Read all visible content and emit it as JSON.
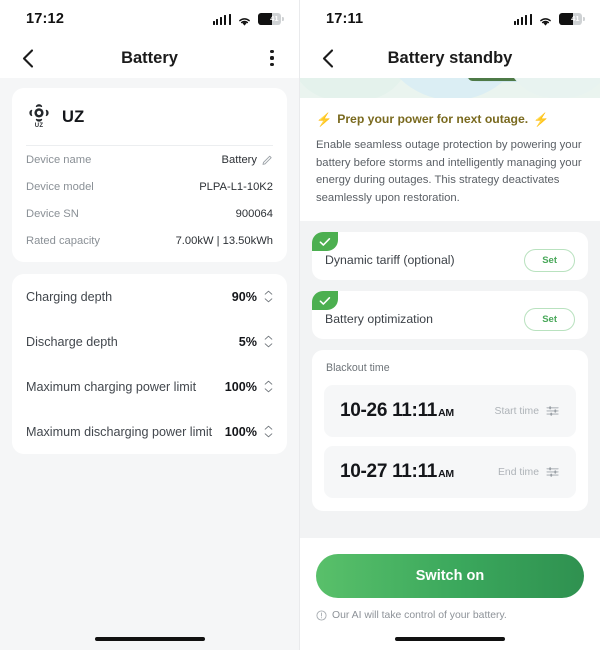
{
  "left": {
    "statusbar": {
      "time": "17:12",
      "battery_level": "41"
    },
    "nav": {
      "title": "Battery",
      "back_icon": "chevron-left-icon",
      "more_icon": "more-vertical-icon"
    },
    "device": {
      "logo_text": "UZ",
      "name": "UZ",
      "rows": [
        {
          "label": "Device name",
          "value": "Battery",
          "icon": "pencil-icon"
        },
        {
          "label": "Device model",
          "value": "PLPA-L1-10K2"
        },
        {
          "label": "Device SN",
          "value": "900064"
        },
        {
          "label": "Rated capacity",
          "value": "7.00kW | 13.50kWh"
        }
      ]
    },
    "settings": [
      {
        "label": "Charging depth",
        "value": "90%"
      },
      {
        "label": "Discharge depth",
        "value": "5%"
      },
      {
        "label": "Maximum charging power limit",
        "value": "100%"
      },
      {
        "label": "Maximum discharging power limit",
        "value": "100%"
      }
    ]
  },
  "right": {
    "statusbar": {
      "time": "17:11",
      "battery_level": "41"
    },
    "nav": {
      "title": "Battery standby",
      "back_icon": "chevron-left-icon"
    },
    "promo": {
      "text": "Prep your power for next outage.",
      "bolt_icon": "lightning-bolt-icon"
    },
    "description": "Enable seamless outage protection by powering your battery before storms and intelligently managing your energy during outages. This strategy deactivates seamlessly upon restoration.",
    "options": [
      {
        "label": "Dynamic tariff (optional)",
        "button": "Set",
        "checked": true
      },
      {
        "label": "Battery optimization",
        "button": "Set",
        "checked": true
      }
    ],
    "blackout": {
      "title": "Blackout time",
      "rows": [
        {
          "value": "10-26 11:11",
          "meridiem": "AM",
          "tag": "Start time",
          "icon": "tune-sliders-icon"
        },
        {
          "value": "10-27 11:11",
          "meridiem": "AM",
          "tag": "End time",
          "icon": "tune-sliders-icon"
        }
      ]
    },
    "footer": {
      "button": "Switch on",
      "note": "Our AI will take control of your battery.",
      "note_icon": "info-circle-icon"
    }
  },
  "colors": {
    "accent_green": "#4caf50",
    "button_green": "#3aa75c",
    "promo_gold": "#7a6a1f"
  }
}
